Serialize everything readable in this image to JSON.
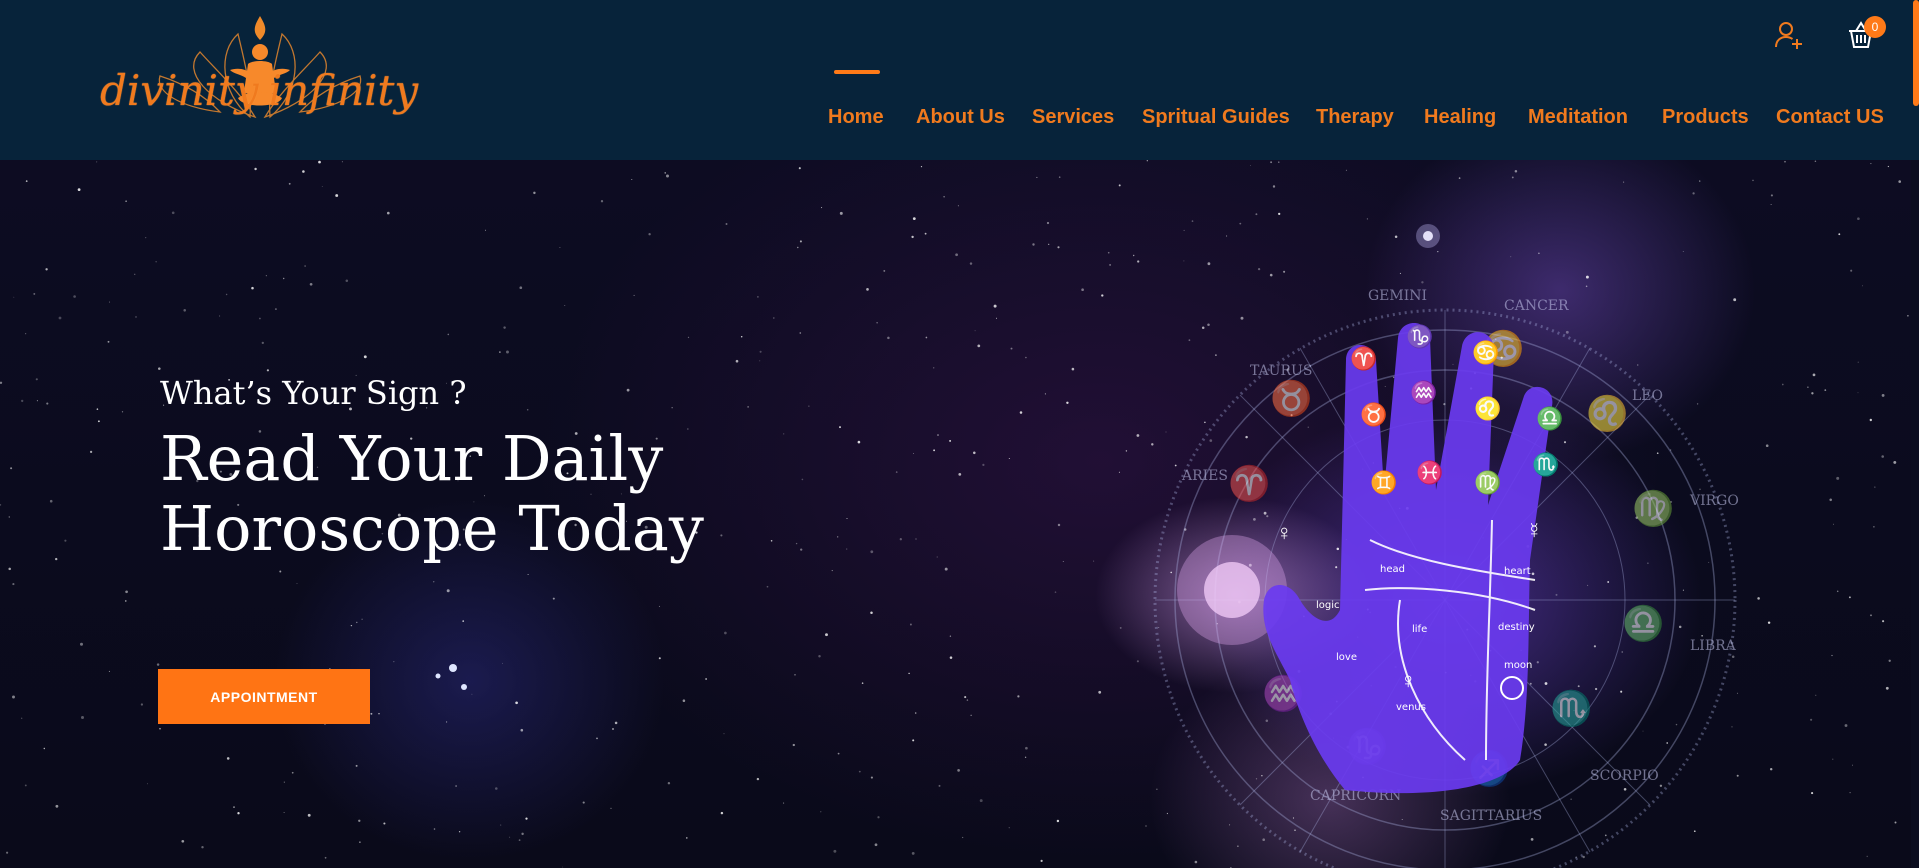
{
  "header": {
    "logo": {
      "brand": "divinity",
      "brand2": "infinity"
    },
    "cart": {
      "count": "0"
    },
    "colors": {
      "background": "#07233a",
      "accent": "#f07a1e"
    },
    "icons": {
      "account": "user-plus-icon",
      "cart": "basket-icon"
    }
  },
  "nav": {
    "active": "Home",
    "items": [
      {
        "label": "Home"
      },
      {
        "label": "About Us"
      },
      {
        "label": "Services"
      },
      {
        "label": "Spritual Guides"
      },
      {
        "label": "Therapy"
      },
      {
        "label": "Healing"
      },
      {
        "label": "Meditation"
      },
      {
        "label": "Products"
      },
      {
        "label": "Contact US"
      }
    ]
  },
  "hero": {
    "eyebrow": "What’s Your Sign ?",
    "headline_line1": "Read Your Daily",
    "headline_line2": "Horoscope Today",
    "cta_label": "APPOINTMENT",
    "cta_color": "#ff7414"
  }
}
